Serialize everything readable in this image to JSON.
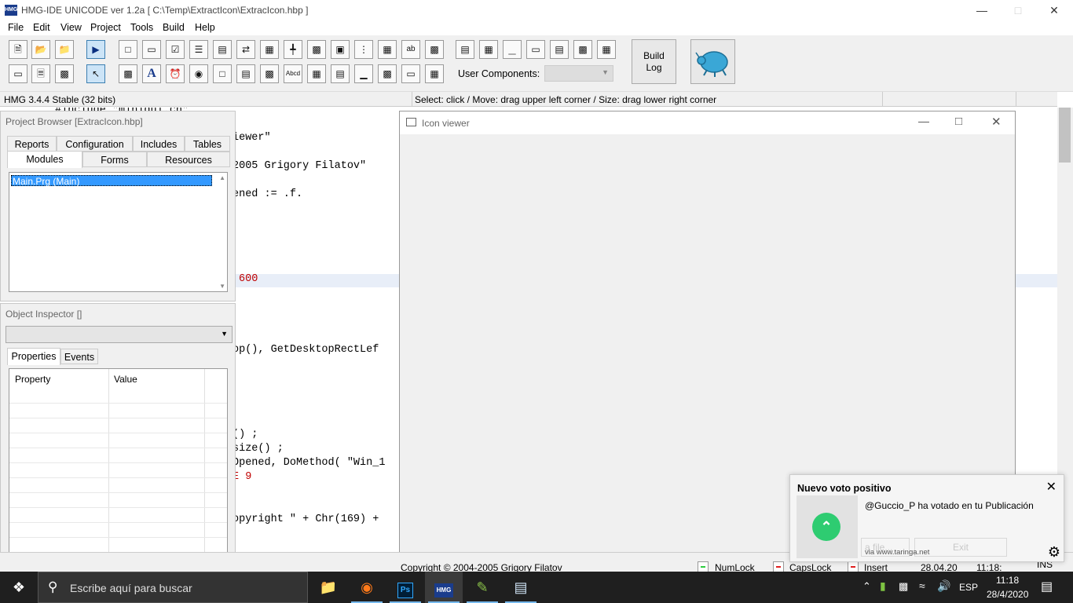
{
  "titlebar": {
    "title": "HMG-IDE  UNICODE  ver 1.2a  [ C:\\Temp\\ExtractIcon\\ExtracIcon.hbp ]",
    "logo_text": "HMG"
  },
  "menu": [
    "File",
    "Edit",
    "View",
    "Project",
    "Tools",
    "Build",
    "Help"
  ],
  "toolbar": {
    "build_log_line1": "Build",
    "build_log_line2": "Log",
    "user_components_label": "User Components:",
    "user_components_value": ""
  },
  "status_top": {
    "left": "HMG 3.4.4 Stable (32 bits)",
    "right": "Select: click / Move: drag upper left corner / Size: drag lower right corner"
  },
  "code_lines": [
    {
      "text": "#include \"minigui.ch\"",
      "color": "#000000"
    },
    {
      "text": "iewer\"",
      "color": "#000000"
    },
    {
      "text": "2005 Grigory Filatov\"",
      "color": "#000000"
    },
    {
      "text": "ened := .f.",
      "color": "#000000"
    },
    {
      "text": "600",
      "color": "#c00000"
    },
    {
      "text": "op(), GetDesktopRectLef",
      "color": "#000000"
    },
    {
      "text": "() ;",
      "color": "#000000"
    },
    {
      "text": "size() ;",
      "color": "#000000"
    },
    {
      "text": "Opened, DoMethod( \"Win_1",
      "color": "#000000"
    },
    {
      "text": "E 9",
      "color": "#c00000"
    },
    {
      "text": "opyright \" + Chr(169) +",
      "color": "#000000"
    }
  ],
  "project_browser": {
    "title": "Project Browser [ExtracIcon.hbp]",
    "tabs_row1": [
      "Reports",
      "Configuration",
      "Includes",
      "Tables"
    ],
    "tabs_row2": [
      "Modules",
      "Forms",
      "Resources"
    ],
    "modules": [
      "Main.Prg (Main)"
    ]
  },
  "object_inspector": {
    "title": "Object Inspector []",
    "combo_value": "",
    "tabs": [
      "Properties",
      "Events"
    ],
    "columns": [
      "Property",
      "Value"
    ]
  },
  "icon_viewer": {
    "title": "Icon viewer",
    "button_file": "a file...",
    "button_exit": "Exit"
  },
  "status_bottom": {
    "copyright": "Copyright © 2004-2005 Grigory Filatov",
    "numlock": "NumLock",
    "capslock": "CapsLock",
    "insert": "Insert",
    "date": "28.04.20",
    "time": "11:18:",
    "ins": "INS"
  },
  "notification": {
    "heading": "Nuevo voto positivo",
    "message": "@Guccio_P ha votado en tu Publicación",
    "via": "via www.taringa.net"
  },
  "taskbar": {
    "search_placeholder": "Escribe aquí para buscar",
    "lang": "ESP",
    "time": "11:18",
    "date": "28/4/2020"
  },
  "colors": {
    "accent": "#3399ff",
    "taskbar": "#1f1f1f",
    "notif_green": "#2ecc71",
    "code_red": "#c00000"
  },
  "icons": [
    "new-file-icon",
    "open-folder-icon",
    "open-project-icon",
    "run-icon",
    "gear-icon",
    "windows-logo-icon",
    "search-icon",
    "file-explorer-icon",
    "firefox-icon",
    "photoshop-icon",
    "hmg-icon"
  ]
}
